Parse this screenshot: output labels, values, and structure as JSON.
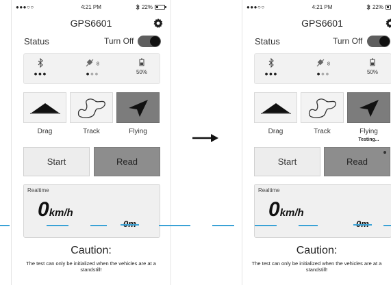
{
  "status_bar": {
    "signal": "●●●○○",
    "time": "4:21 PM",
    "bluetooth_icon": "bluetooth-icon",
    "battery": "22%",
    "battery_level": 0.22
  },
  "header": {
    "title": "GPS6601",
    "settings_icon": "gear-icon"
  },
  "status_row": {
    "label": "Status",
    "toggle_label": "Turn Off",
    "toggle_on": true
  },
  "indicators": {
    "bluetooth": {
      "icon": "bluetooth-icon"
    },
    "satellites": {
      "icon": "satellite-icon",
      "count": "8"
    },
    "battery": {
      "icon": "battery-icon",
      "value": "50%"
    }
  },
  "modes": [
    {
      "label": "Drag",
      "icon": "drag-icon"
    },
    {
      "label": "Track",
      "icon": "track-icon"
    },
    {
      "label": "Flying",
      "icon": "flying-icon"
    }
  ],
  "testing_label": "Testing...",
  "buttons": {
    "start": "Start",
    "read": "Read"
  },
  "realtime": {
    "label": "Realtime",
    "speed": "0",
    "unit": "km/h",
    "distance": "0m"
  },
  "caution": {
    "title": "Caution:",
    "text": "The test can only be initialized when the vehicles are at a standstill!"
  },
  "colors": {
    "accent": "#3aa2d6",
    "active_mode": "#7c7c7c",
    "read_button": "#8d8d8d"
  }
}
